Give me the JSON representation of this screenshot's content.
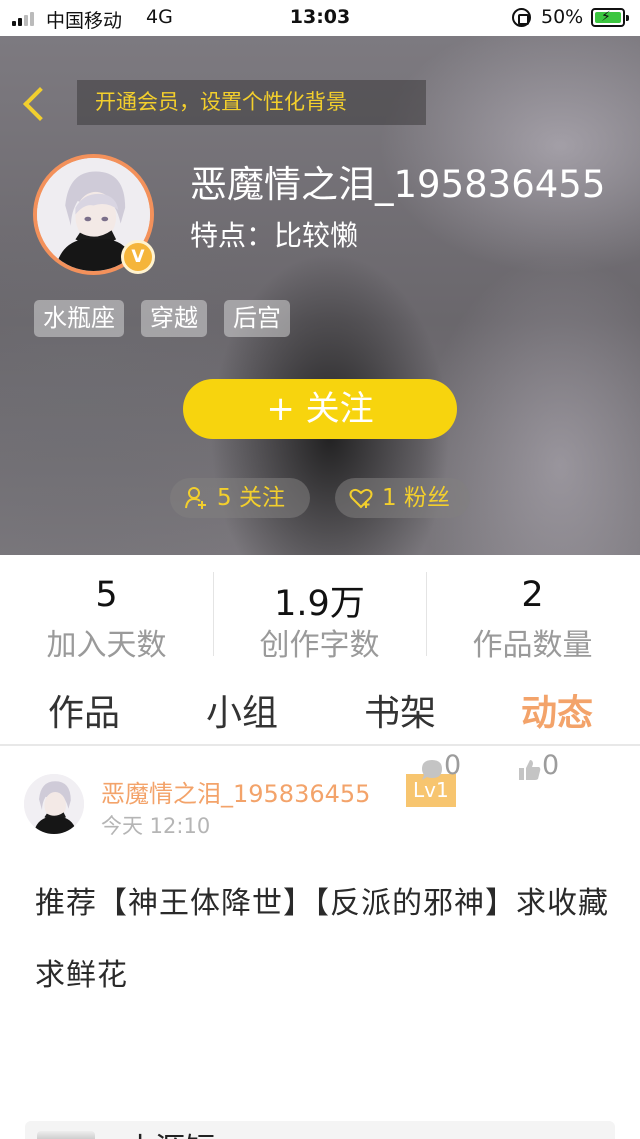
{
  "status_bar": {
    "carrier": "中国移动",
    "network": "4G",
    "time": "13:03",
    "battery": "50%"
  },
  "header": {
    "vip_banner": "开通会员，设置个性化背景",
    "user_name": "恶魔情之泪_195836455",
    "feature": "特点：比较懒",
    "vip_badge": "V",
    "tags": [
      "水瓶座",
      "穿越",
      "后宫"
    ],
    "follow_button": "+  关注",
    "following": "5 关注",
    "fans": "1 粉丝",
    "accent_color": "#f7d40e"
  },
  "stats": [
    {
      "value": "5",
      "label": "加入天数"
    },
    {
      "value": "1.9万",
      "label": "创作字数"
    },
    {
      "value": "2",
      "label": "作品数量"
    }
  ],
  "tabs": [
    {
      "label": "作品",
      "active": false
    },
    {
      "label": "小组",
      "active": false
    },
    {
      "label": "书架",
      "active": false
    },
    {
      "label": "动态",
      "active": true
    }
  ],
  "post": {
    "author": "恶魔情之泪_195836455",
    "level": "Lv1",
    "time": "今天 12:10",
    "content": "推荐【神王体降世】【反派的邪神】求收藏求鲜花",
    "comments": "0",
    "likes": "0"
  },
  "next_post": {
    "title": "小源短..."
  },
  "icons": [
    "back-chevron-icon",
    "signal-icon",
    "orientation-lock-icon",
    "battery-icon",
    "vip-icon",
    "add-user-icon",
    "heart-plus-icon",
    "comment-icon",
    "thumbs-up-icon"
  ]
}
